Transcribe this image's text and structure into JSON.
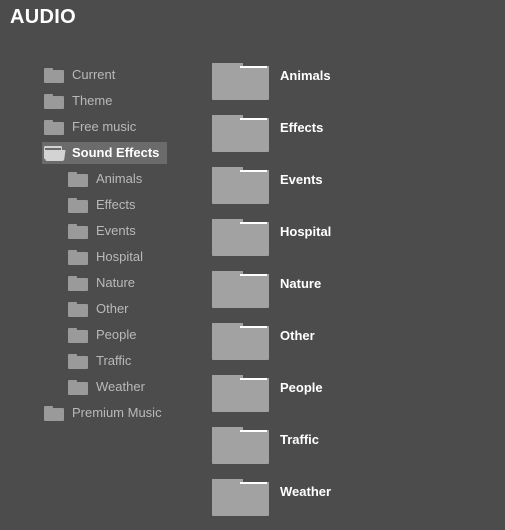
{
  "header": {
    "title": "AUDIO"
  },
  "colors": {
    "background": "#4c4c4c",
    "selection": "#6b6b6b",
    "folder_icon": "#9a9a9a",
    "folder_thumb": "#a2a2a2",
    "tree_text": "#b9b9b9",
    "label_text": "#ffffff"
  },
  "tree": {
    "items": [
      {
        "label": "Current",
        "level": 0,
        "selected": false,
        "icon": "folder-icon"
      },
      {
        "label": "Theme",
        "level": 0,
        "selected": false,
        "icon": "folder-icon"
      },
      {
        "label": "Free music",
        "level": 0,
        "selected": false,
        "icon": "folder-icon"
      },
      {
        "label": "Sound Effects",
        "level": 0,
        "selected": true,
        "icon": "folder-open-icon"
      },
      {
        "label": "Animals",
        "level": 1,
        "selected": false,
        "icon": "folder-icon"
      },
      {
        "label": "Effects",
        "level": 1,
        "selected": false,
        "icon": "folder-icon"
      },
      {
        "label": "Events",
        "level": 1,
        "selected": false,
        "icon": "folder-icon"
      },
      {
        "label": "Hospital",
        "level": 1,
        "selected": false,
        "icon": "folder-icon"
      },
      {
        "label": "Nature",
        "level": 1,
        "selected": false,
        "icon": "folder-icon"
      },
      {
        "label": "Other",
        "level": 1,
        "selected": false,
        "icon": "folder-icon"
      },
      {
        "label": "People",
        "level": 1,
        "selected": false,
        "icon": "folder-icon"
      },
      {
        "label": "Traffic",
        "level": 1,
        "selected": false,
        "icon": "folder-icon"
      },
      {
        "label": "Weather",
        "level": 1,
        "selected": false,
        "icon": "folder-icon"
      },
      {
        "label": "Premium Music",
        "level": 0,
        "selected": false,
        "icon": "folder-icon"
      }
    ]
  },
  "grid": {
    "items": [
      {
        "label": "Animals",
        "icon": "folder-thumbnail-icon"
      },
      {
        "label": "Effects",
        "icon": "folder-thumbnail-icon"
      },
      {
        "label": "Events",
        "icon": "folder-thumbnail-icon"
      },
      {
        "label": "Hospital",
        "icon": "folder-thumbnail-icon"
      },
      {
        "label": "Nature",
        "icon": "folder-thumbnail-icon"
      },
      {
        "label": "Other",
        "icon": "folder-thumbnail-icon"
      },
      {
        "label": "People",
        "icon": "folder-thumbnail-icon"
      },
      {
        "label": "Traffic",
        "icon": "folder-thumbnail-icon"
      },
      {
        "label": "Weather",
        "icon": "folder-thumbnail-icon"
      }
    ]
  }
}
